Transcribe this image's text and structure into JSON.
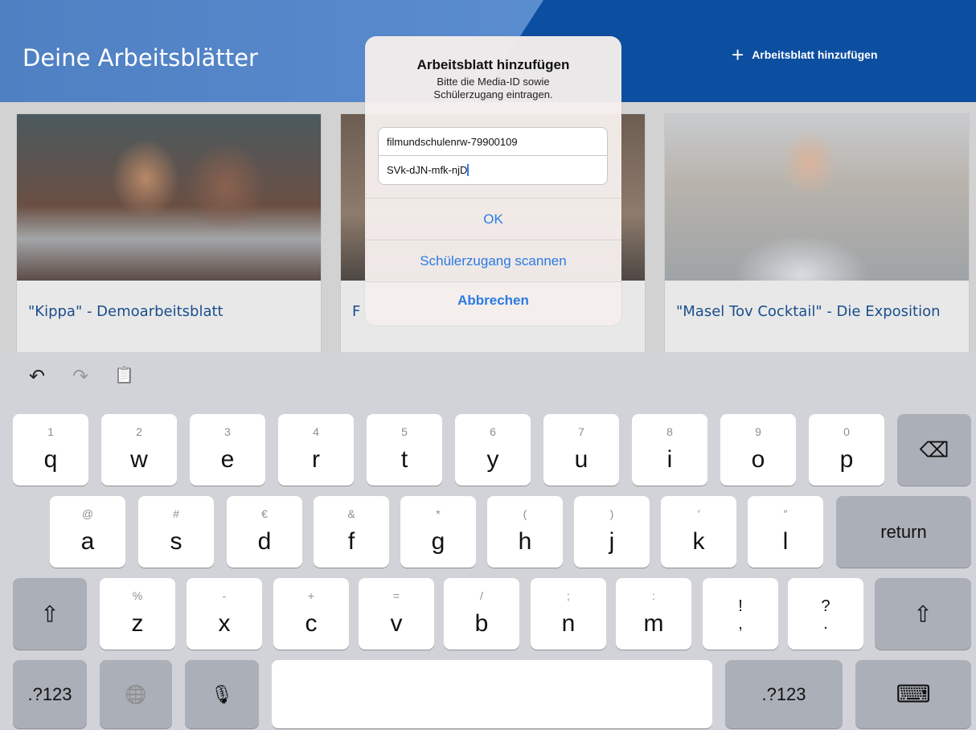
{
  "header": {
    "title": "Deine Arbeitsblätter",
    "add_label": "Arbeitsblatt hinzufügen",
    "add_icon": "+"
  },
  "cards": [
    {
      "caption": "\"Kippa\" - Demoarbeitsblatt"
    },
    {
      "caption": "F"
    },
    {
      "caption": "\"Masel Tov Cocktail\" - Die Exposition"
    }
  ],
  "dialog": {
    "title": "Arbeitsblatt hinzufügen",
    "message": "Bitte die Media-ID sowie Schülerzugang eintragen.",
    "field1_value": "filmundschulenrw-79900109",
    "field2_value": "SVk-dJN-mfk-njD",
    "ok": "OK",
    "scan": "Schülerzugang scannen",
    "cancel": "Abbrechen"
  },
  "keyboard": {
    "toolbar": {
      "undo": "↶",
      "redo": "↷",
      "paste": "📋"
    },
    "row1": [
      {
        "hint": "1",
        "key": "q"
      },
      {
        "hint": "2",
        "key": "w"
      },
      {
        "hint": "3",
        "key": "e"
      },
      {
        "hint": "4",
        "key": "r"
      },
      {
        "hint": "5",
        "key": "t"
      },
      {
        "hint": "6",
        "key": "y"
      },
      {
        "hint": "7",
        "key": "u"
      },
      {
        "hint": "8",
        "key": "i"
      },
      {
        "hint": "9",
        "key": "o"
      },
      {
        "hint": "0",
        "key": "p"
      }
    ],
    "backspace": "⌫",
    "row2": [
      {
        "hint": "@",
        "key": "a"
      },
      {
        "hint": "#",
        "key": "s"
      },
      {
        "hint": "€",
        "key": "d"
      },
      {
        "hint": "&",
        "key": "f"
      },
      {
        "hint": "*",
        "key": "g"
      },
      {
        "hint": "(",
        "key": "h"
      },
      {
        "hint": ")",
        "key": "j"
      },
      {
        "hint": "′",
        "key": "k"
      },
      {
        "hint": "″",
        "key": "l"
      }
    ],
    "return": "return",
    "shift": "⇧",
    "row3": [
      {
        "hint": "%",
        "key": "z"
      },
      {
        "hint": "-",
        "key": "x"
      },
      {
        "hint": "+",
        "key": "c"
      },
      {
        "hint": "=",
        "key": "v"
      },
      {
        "hint": "/",
        "key": "b"
      },
      {
        "hint": ";",
        "key": "n"
      },
      {
        "hint": ":",
        "key": "m"
      }
    ],
    "excl": "!",
    "comma": ",",
    "question": "?",
    "period": ".",
    "numbers_left": ".?123",
    "numbers_right": ".?123",
    "globe": "🌐",
    "mic": "🎙",
    "hide_keyboard": "⌨"
  }
}
